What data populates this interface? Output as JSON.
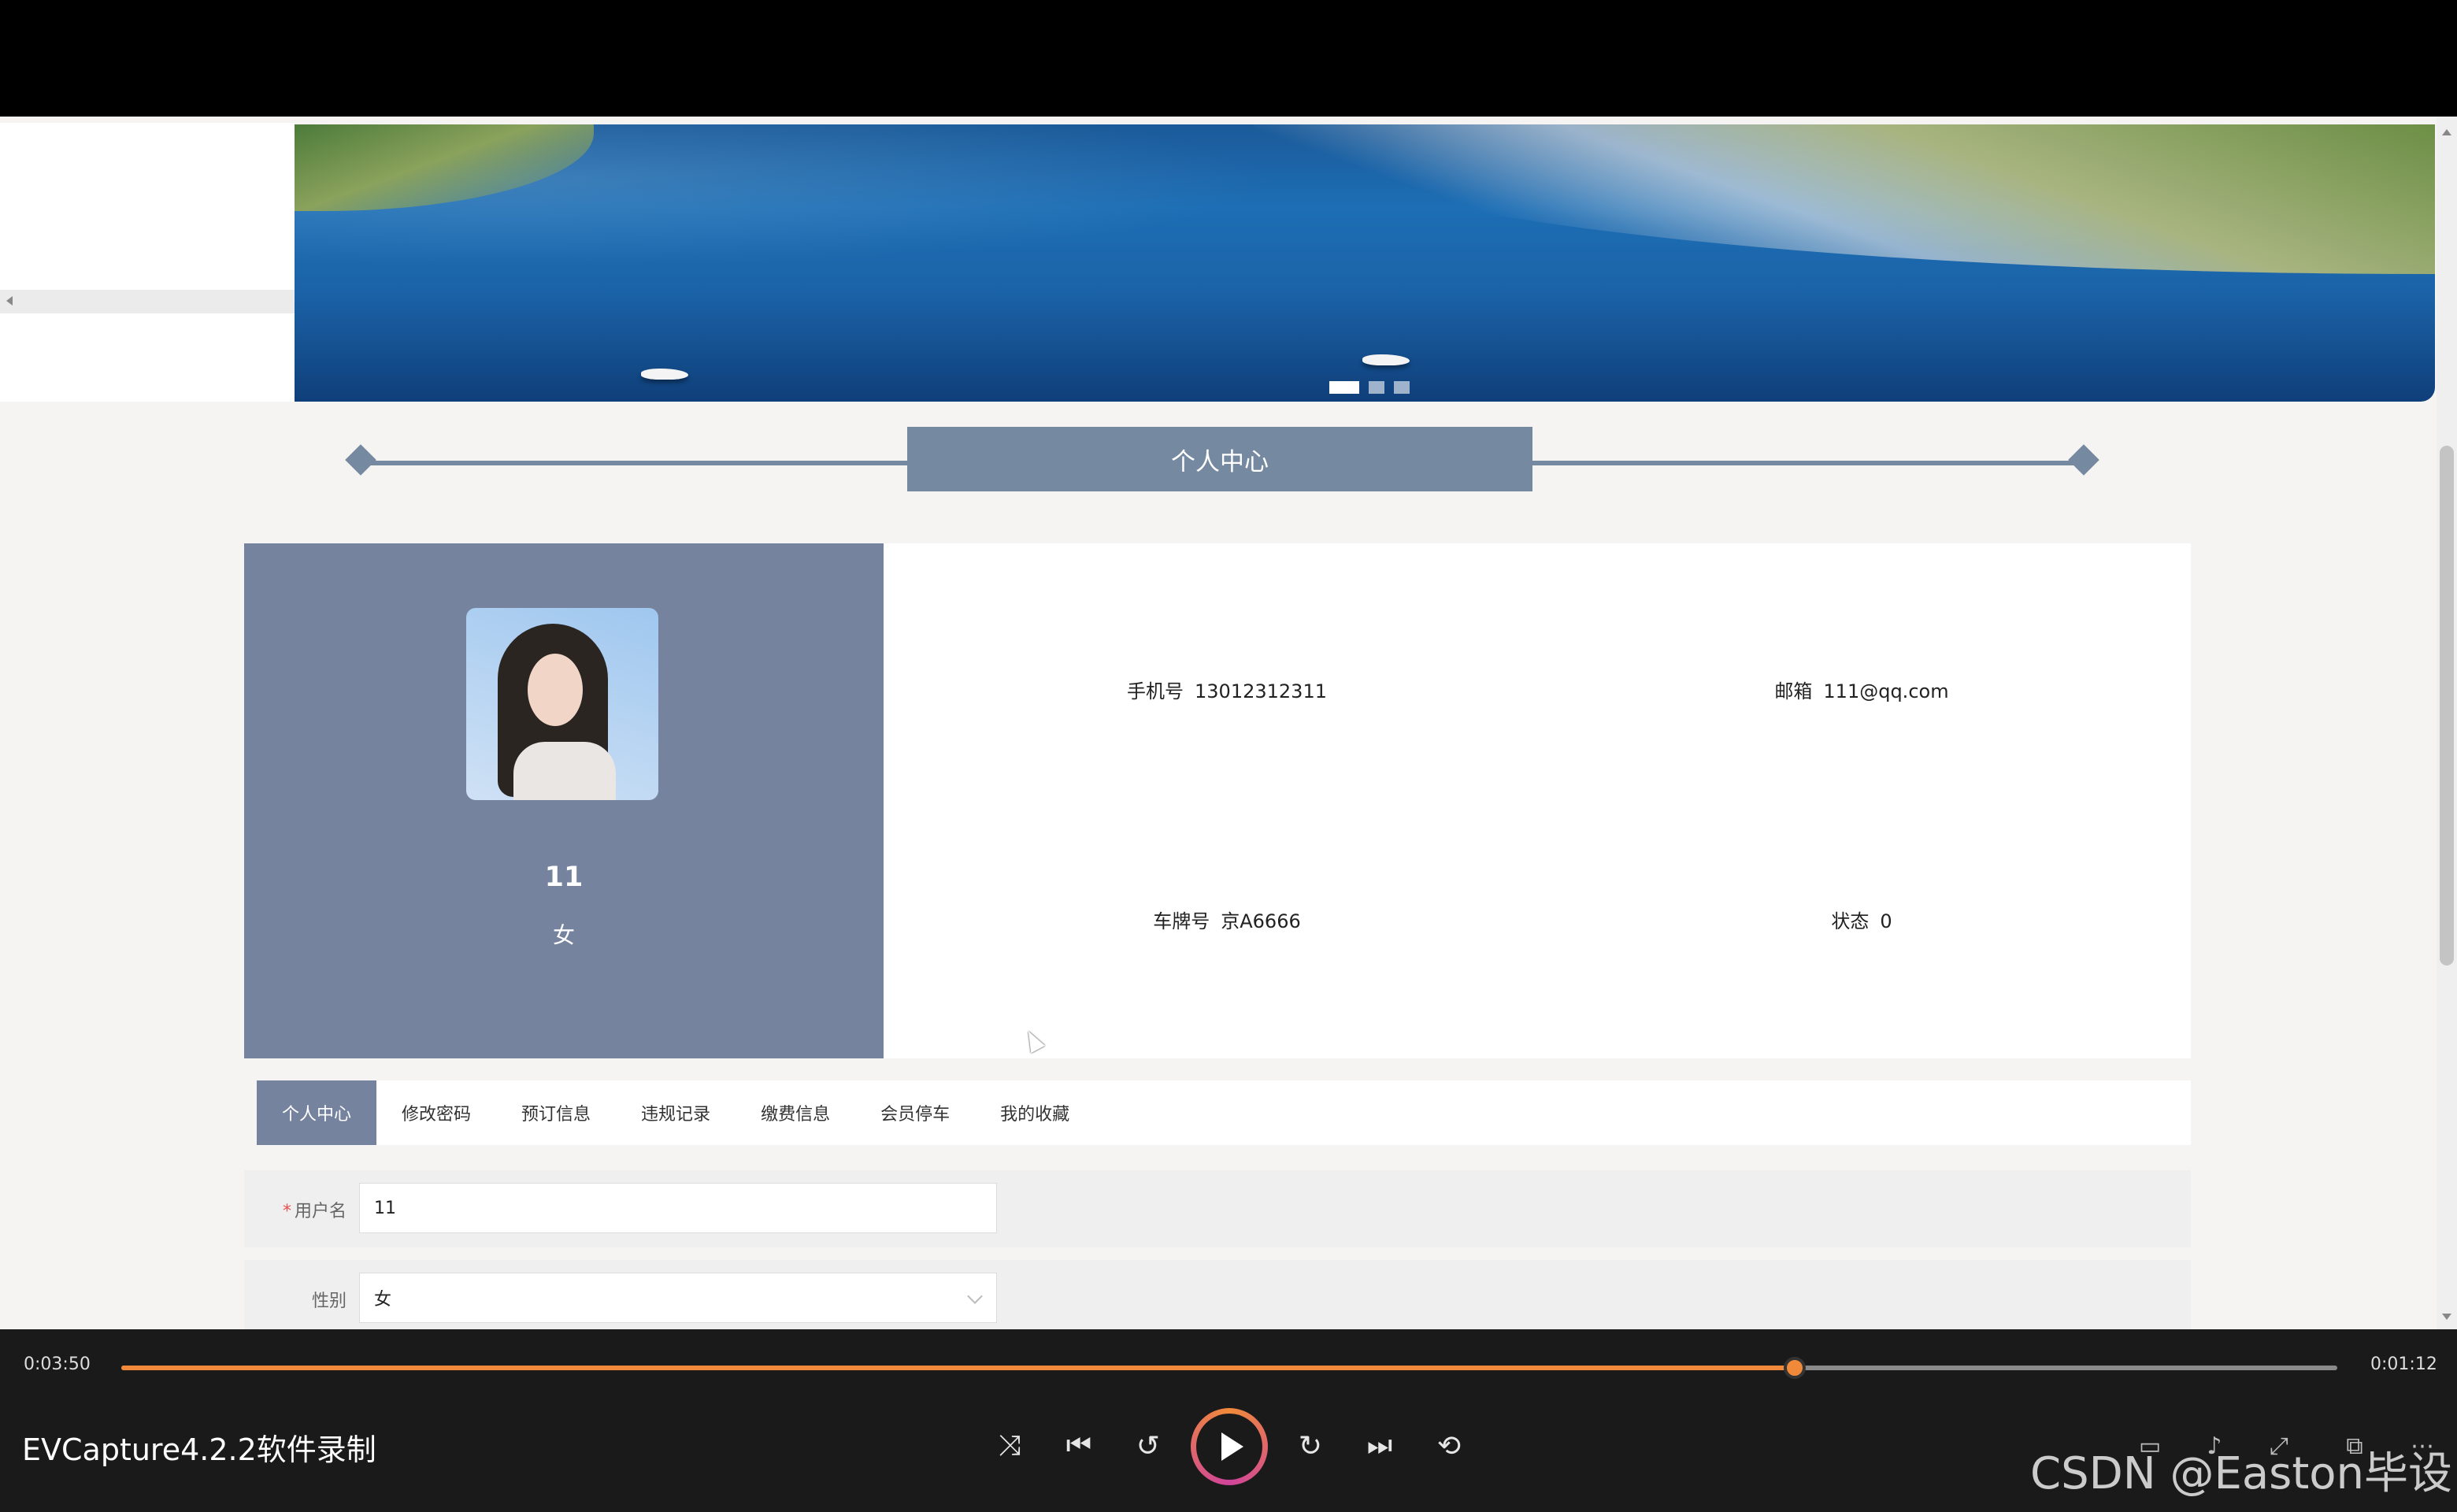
{
  "section": {
    "title": "个人中心"
  },
  "profile": {
    "username": "11",
    "gender": "女",
    "fields": [
      {
        "key": "手机号",
        "value": "13012312311"
      },
      {
        "key": "邮箱",
        "value": "111@qq.com"
      },
      {
        "key": "车牌号",
        "value": "京A6666"
      },
      {
        "key": "状态",
        "value": "0"
      }
    ]
  },
  "tabs": [
    {
      "label": "个人中心",
      "active": true
    },
    {
      "label": "修改密码"
    },
    {
      "label": "预订信息"
    },
    {
      "label": "违规记录"
    },
    {
      "label": "缴费信息"
    },
    {
      "label": "会员停车"
    },
    {
      "label": "我的收藏"
    }
  ],
  "form": {
    "username_label": "用户名",
    "username_required": "*",
    "username_value": "11",
    "gender_label": "性别",
    "gender_value": "女"
  },
  "carousel": {
    "count": 3,
    "active_index": 0
  },
  "player": {
    "elapsed": "0:03:50",
    "remaining": "0:01:12",
    "progress_fraction": 0.755,
    "title": "EVCapture4.2.2软件录制",
    "controls": [
      "shuffle-icon",
      "previous-icon",
      "rewind-10-icon",
      "play-icon",
      "forward-30-icon",
      "next-icon",
      "repeat-off-icon"
    ],
    "right_controls": [
      "subtitles-icon",
      "volume-icon",
      "fullscreen-icon",
      "mini-player-icon",
      "more-icon"
    ],
    "accent": "#f08a3a"
  },
  "watermark": "CSDN @Easton毕设"
}
